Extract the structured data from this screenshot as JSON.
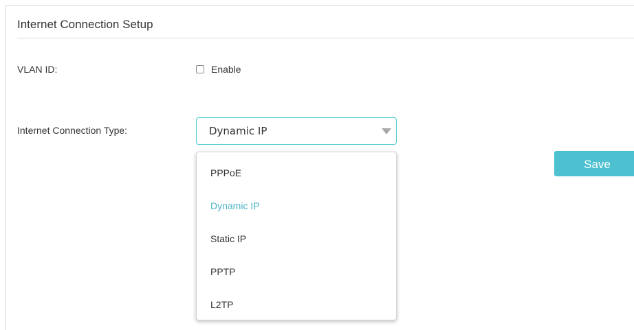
{
  "section": {
    "title": "Internet Connection Setup"
  },
  "vlan": {
    "label": "VLAN ID:",
    "checkbox_label": "Enable",
    "checked": false
  },
  "connection_type": {
    "label": "Internet Connection Type:",
    "selected_value": "Dynamic IP",
    "options": [
      "PPPoE",
      "Dynamic IP",
      "Static IP",
      "PPTP",
      "L2TP"
    ],
    "selected_index": 1
  },
  "save": {
    "label": "Save"
  },
  "colors": {
    "accent": "#4dc1d0",
    "selected_option": "#4cb3c7",
    "select_border": "#4acbd6"
  }
}
